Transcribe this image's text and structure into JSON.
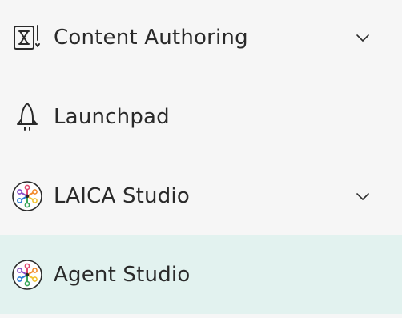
{
  "nav": {
    "items": [
      {
        "label": "Content Authoring",
        "icon": "content-authoring-icon",
        "expandable": true,
        "selected": false
      },
      {
        "label": "Launchpad",
        "icon": "rocket-icon",
        "expandable": false,
        "selected": false
      },
      {
        "label": "LAICA Studio",
        "icon": "laica-network-icon",
        "expandable": true,
        "selected": false
      },
      {
        "label": "Agent Studio",
        "icon": "agent-network-icon",
        "expandable": false,
        "selected": true
      }
    ]
  },
  "colors": {
    "background": "#f6f6f6",
    "selected_background": "#e2f2ef",
    "text": "#2a2a2a"
  }
}
